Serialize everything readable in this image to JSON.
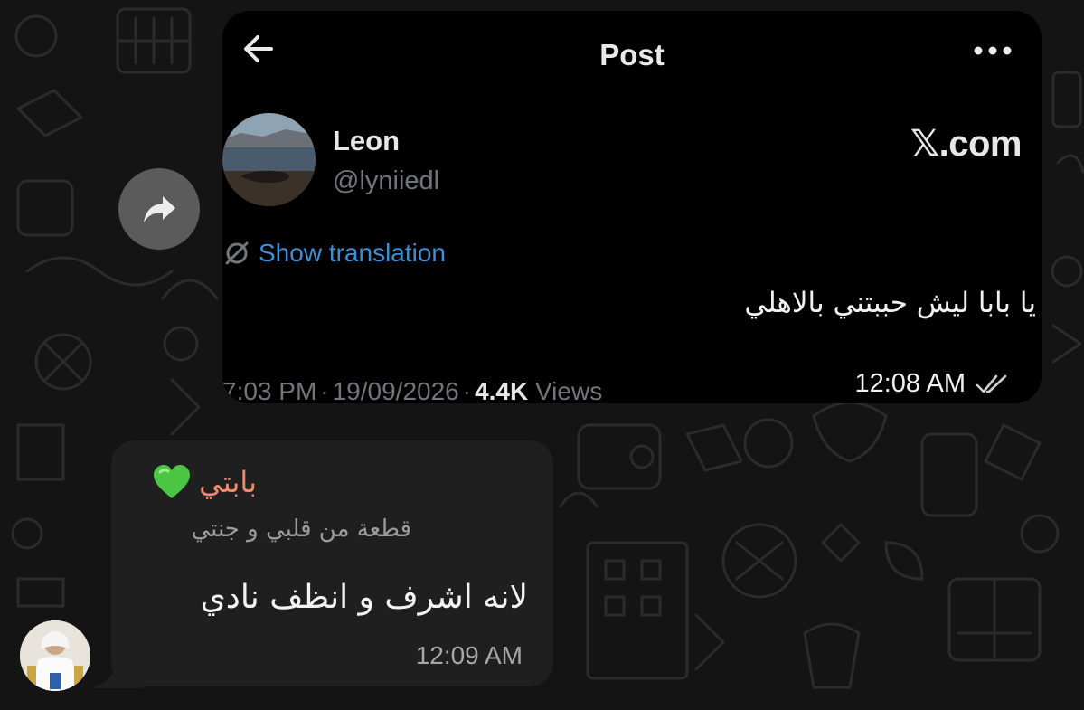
{
  "post": {
    "title": "Post",
    "author_name": "Leon",
    "author_handle": "@lyniiedl",
    "brand": "𝕏.com",
    "translate_label": "Show translation",
    "text": "يا بابا ليش حببتني بالاهلي",
    "time": "7:03 PM",
    "date": "19/09/2026",
    "views_count": "4.4K",
    "views_label": "Views",
    "separator": "·",
    "link_color": "#3d8fd6"
  },
  "outgoing_message": {
    "time": "12:08 AM",
    "status_icon": "double-check-icon"
  },
  "incoming_message": {
    "sender_name": "بابتي",
    "sender_emoji": "green-heart-icon",
    "sender_status": "قطعة من قلبي و جنتي",
    "text": "لانه اشرف و انظف نادي",
    "time": "12:09 AM",
    "name_color": "#ee8a6e"
  },
  "icons": {
    "back": "back-arrow-icon",
    "more": "more-icon",
    "forward": "forward-icon",
    "translate": "translate-icon"
  }
}
